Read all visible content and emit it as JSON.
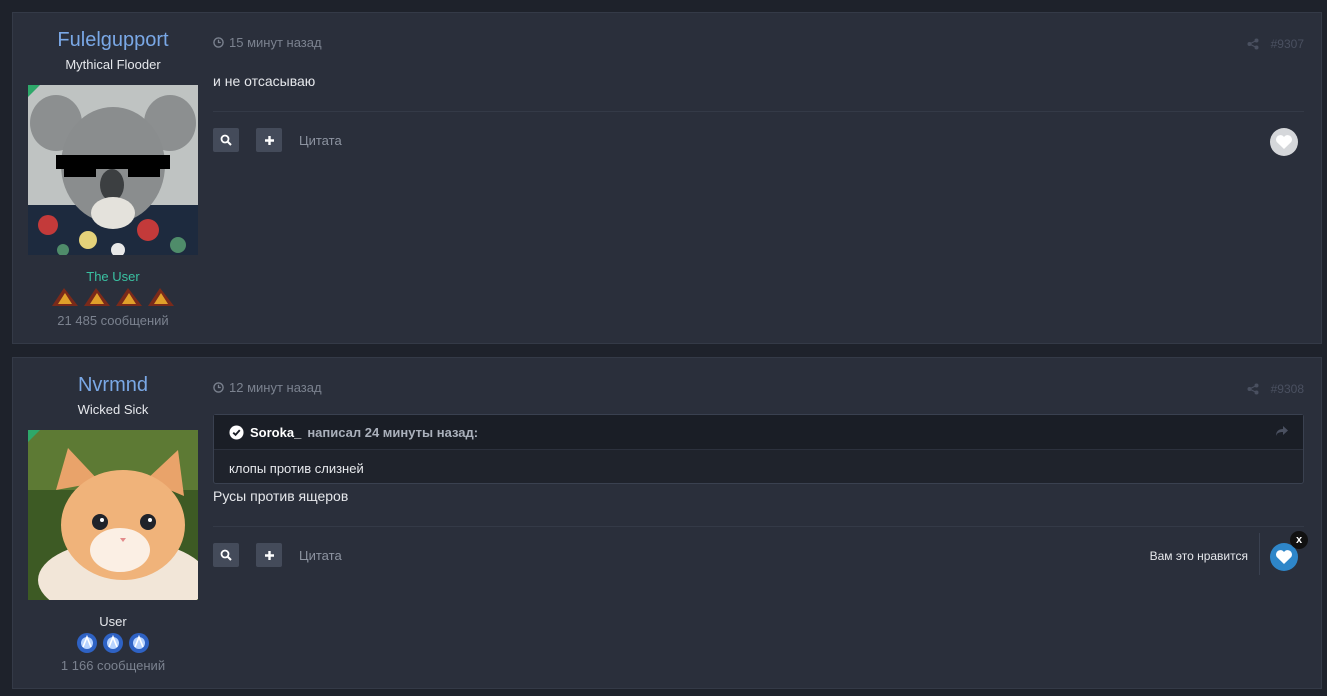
{
  "posts": [
    {
      "author": "Fulelgupport",
      "title": "Mythical Flooder",
      "group": "The User",
      "group_color": "#3ac1a2",
      "post_count": "21 485 сообщений",
      "time": "15 минут назад",
      "number": "#9307",
      "text": "и не отсасываю",
      "quote_label": "Цитата"
    },
    {
      "author": "Nvrmnd",
      "title": "Wicked Sick",
      "group": "User",
      "group_color": "#e6e8ec",
      "post_count": "1 166 сообщений",
      "time": "12 минут назад",
      "number": "#9308",
      "quote": {
        "author": "Soroka_",
        "meta": "написал 24 минуты назад:",
        "text": "клопы против слизней"
      },
      "text": "Русы против ящеров",
      "quote_label": "Цитата",
      "like_text": "Вам это нравится",
      "remove_like": "x"
    }
  ]
}
